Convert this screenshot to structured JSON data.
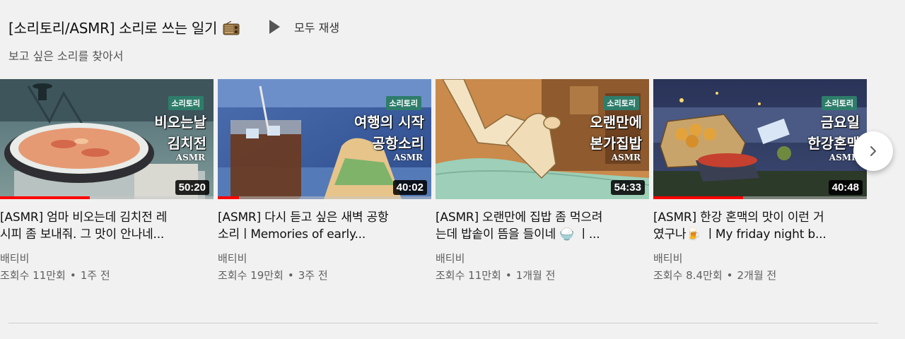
{
  "shelf": {
    "title": "[소리토리/ASMR] 소리로 쓰는 일기",
    "title_icon": "radio-icon",
    "play_all_label": "모두 재생",
    "subtitle": "보고 싶은 소리를 찾아서"
  },
  "videos": [
    {
      "thumb_brand": "소리토리",
      "thumb_line1": "비오는날",
      "thumb_line2": "김치전",
      "thumb_asmr": "ASMR",
      "duration": "50:20",
      "progress": 0.42,
      "title_line1": "[ASMR] 엄마 비오는데 김치전 레",
      "title_line2": "시피 좀 보내줘. 그 맛이 안나네...",
      "channel": "배티비",
      "views": "조회수 11만회",
      "age": "1주 전"
    },
    {
      "thumb_brand": "소리토리",
      "thumb_line1": "여행의 시작",
      "thumb_line2": "공항소리",
      "thumb_asmr": "ASMR",
      "duration": "40:02",
      "progress": 0.1,
      "title_line1": "[ASMR] 다시 듣고 싶은 새벽 공항",
      "title_line2": "소리ㅣMemories of early...",
      "channel": "배티비",
      "views": "조회수 19만회",
      "age": "3주 전"
    },
    {
      "thumb_brand": "소리토리",
      "thumb_line1": "오랜만에",
      "thumb_line2": "본가집밥",
      "thumb_asmr": "ASMR",
      "duration": "54:33",
      "progress": 0,
      "title_line1": "[ASMR] 오랜만에 집밥 좀 먹으려",
      "title_line2": "는데 밥솥이 뜸을 들이네 🍚 ㅣ...",
      "channel": "배티비",
      "views": "조회수 11만회",
      "age": "1개월 전"
    },
    {
      "thumb_brand": "소리토리",
      "thumb_line1": "금요일",
      "thumb_line2": "한강혼맥",
      "thumb_asmr": "ASMR",
      "duration": "40:48",
      "progress": 0.42,
      "title_line1": "[ASMR] 한강 혼맥의 맛이 이런 거",
      "title_line2": "였구나🍺 ㅣMy friday night b...",
      "channel": "배티비",
      "views": "조회수 8.4만회",
      "age": "2개월 전"
    }
  ],
  "next_button_icon": "chevron-right-icon",
  "colors": {
    "background": "#f1f1f1",
    "progress": "#ff0000",
    "secondary_text": "#606060",
    "brand_tag": "#2e7d6b"
  }
}
